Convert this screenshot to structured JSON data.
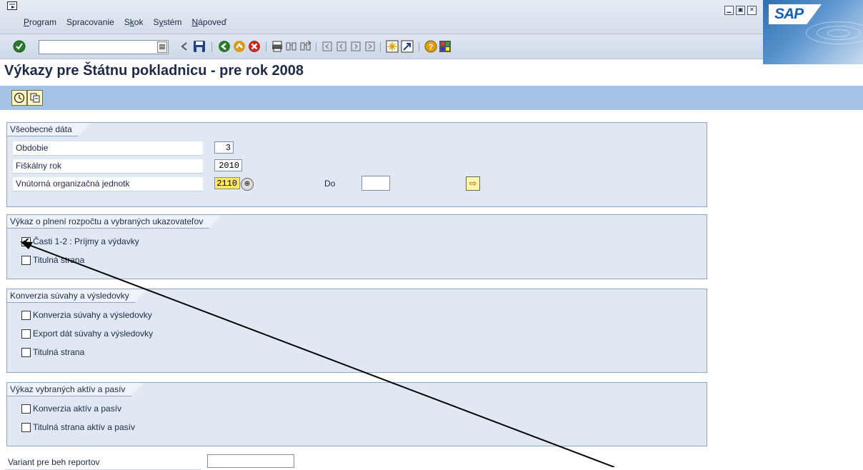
{
  "menu": {
    "items": [
      {
        "pre": "",
        "u": "P",
        "post": "rogram"
      },
      {
        "pre": "Spracovanie",
        "u": "",
        "post": ""
      },
      {
        "pre": "S",
        "u": "k",
        "post": "ok"
      },
      {
        "pre": "S",
        "u": "y",
        "post": "stém"
      },
      {
        "pre": "",
        "u": "N",
        "post": "ápoveď"
      }
    ]
  },
  "brand": {
    "logo_text": "SAP"
  },
  "page": {
    "title": "Výkazy pre Štátnu pokladnicu - pre rok 2008"
  },
  "general": {
    "title": "Všeobecné dáta",
    "obdobie_label": "Obdobie",
    "obdobie_value": "3",
    "rok_label": "Fiškálny rok",
    "rok_value": "2010",
    "jednotka_label": "Vnútorná organizačná jednotk",
    "jednotka_value": "2110",
    "do_label": "Do",
    "do_value": ""
  },
  "budget": {
    "title": "Výkaz o plnení rozpočtu a vybraných ukazovateľov",
    "items": [
      {
        "label": "Časti 1-2 : Príjmy a výdavky",
        "checked": true
      },
      {
        "label": "Titulná strana",
        "checked": false
      }
    ]
  },
  "conversion": {
    "title": "Konverzia súvahy a výsledovky",
    "items": [
      {
        "label": "Konverzia súvahy a výsledovky",
        "checked": false
      },
      {
        "label": "Export dát súvahy a výsledovky",
        "checked": false
      },
      {
        "label": "Titulná strana",
        "checked": false
      }
    ]
  },
  "assets": {
    "title": "Výkaz vybraných aktív a pasív",
    "items": [
      {
        "label": "Konverzia aktív a pasív",
        "checked": false
      },
      {
        "label": "Titulná strana  aktív a pasív",
        "checked": false
      }
    ]
  },
  "variant": {
    "label": "Variant pre beh reportov",
    "value": ""
  }
}
